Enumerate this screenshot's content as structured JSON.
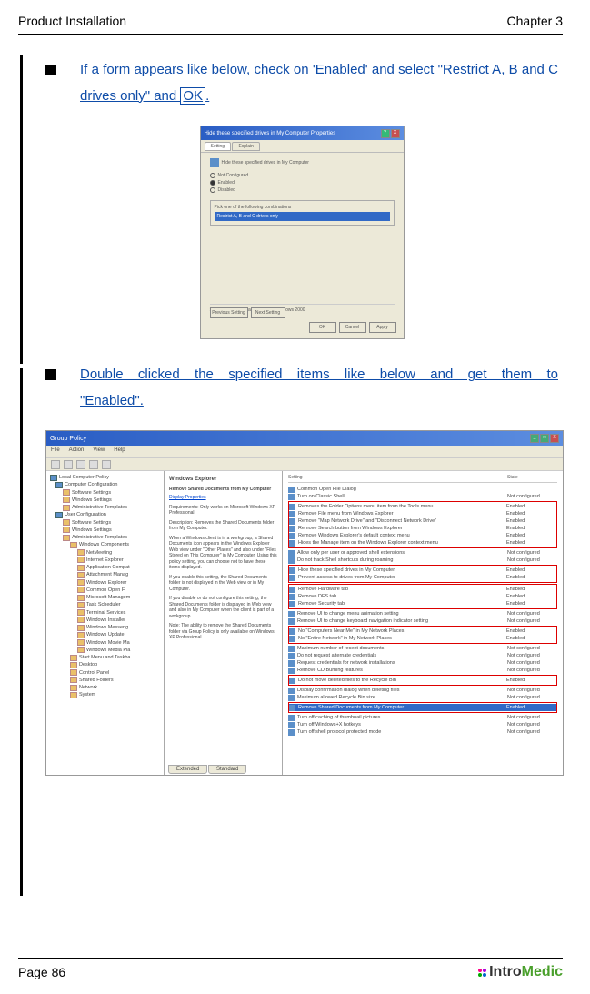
{
  "header": {
    "left": "Product Installation",
    "right": "Chapter 3"
  },
  "bullet1": {
    "pre": "If a form appears like below, check on 'Enabled' and select \"Restrict A, B and C drives only\" and ",
    "ok": "OK",
    "post": "."
  },
  "bullet2": "Double clicked the specified items like below and get them to \"Enabled\".",
  "ss1": {
    "title": "Hide these specified drives in My Computer Properties",
    "tab1": "Setting",
    "tab2": "Explain",
    "header_label": "Hide these specified drives in My Computer",
    "r1": "Not Configured",
    "r2": "Enabled",
    "r3": "Disabled",
    "pick": "Pick one of the following combinations",
    "selected": "Restrict A, B and C drives only",
    "supported": "Supported on:   At least Microsoft Windows 2000",
    "prev": "Previous Setting",
    "next": "Next Setting",
    "ok": "OK",
    "cancel": "Cancel",
    "apply": "Apply"
  },
  "ss2": {
    "title": "Group Policy",
    "menu": [
      "File",
      "Action",
      "View",
      "Help"
    ],
    "tree": [
      {
        "t": "Local Computer Policy",
        "i": 0,
        "c": "blue"
      },
      {
        "t": "Computer Configuration",
        "i": 1,
        "c": "blue"
      },
      {
        "t": "Software Settings",
        "i": 2,
        "c": ""
      },
      {
        "t": "Windows Settings",
        "i": 2,
        "c": ""
      },
      {
        "t": "Administrative Templates",
        "i": 2,
        "c": ""
      },
      {
        "t": "User Configuration",
        "i": 1,
        "c": "blue"
      },
      {
        "t": "Software Settings",
        "i": 2,
        "c": ""
      },
      {
        "t": "Windows Settings",
        "i": 2,
        "c": ""
      },
      {
        "t": "Administrative Templates",
        "i": 2,
        "c": ""
      },
      {
        "t": "Windows Components",
        "i": 3,
        "c": ""
      },
      {
        "t": "NetMeeting",
        "i": 4,
        "c": ""
      },
      {
        "t": "Internet Explorer",
        "i": 4,
        "c": ""
      },
      {
        "t": "Application Compat",
        "i": 4,
        "c": ""
      },
      {
        "t": "Attachment Manag",
        "i": 4,
        "c": ""
      },
      {
        "t": "Windows Explorer",
        "i": 4,
        "c": ""
      },
      {
        "t": "Common Open F",
        "i": 4,
        "c": ""
      },
      {
        "t": "Microsoft Managem",
        "i": 4,
        "c": ""
      },
      {
        "t": "Task Scheduler",
        "i": 4,
        "c": ""
      },
      {
        "t": "Terminal Services",
        "i": 4,
        "c": ""
      },
      {
        "t": "Windows Installer",
        "i": 4,
        "c": ""
      },
      {
        "t": "Windows Messeng",
        "i": 4,
        "c": ""
      },
      {
        "t": "Windows Update",
        "i": 4,
        "c": ""
      },
      {
        "t": "Windows Movie Ma",
        "i": 4,
        "c": ""
      },
      {
        "t": "Windows Media Pla",
        "i": 4,
        "c": ""
      },
      {
        "t": "Start Menu and Taskba",
        "i": 3,
        "c": ""
      },
      {
        "t": "Desktop",
        "i": 3,
        "c": ""
      },
      {
        "t": "Control Panel",
        "i": 3,
        "c": ""
      },
      {
        "t": "Shared Folders",
        "i": 3,
        "c": ""
      },
      {
        "t": "Network",
        "i": 3,
        "c": ""
      },
      {
        "t": "System",
        "i": 3,
        "c": ""
      }
    ],
    "explain_title": "Windows Explorer",
    "explain_head": "Remove Shared Documents from My Computer",
    "explain_link": "Display Properties",
    "explain_req": "Requirements: Only works on Microsoft Windows XP Professional",
    "explain_desc": "Description: Removes the Shared Documents folder from My Computer.",
    "explain_p1": "When a Windows client is in a workgroup, a Shared Documents icon appears in the Windows Explorer Web view under \"Other Places\" and also under \"Files Stored on This Computer\" in My Computer. Using this policy setting, you can choose not to have these items displayed.",
    "explain_p2": "If you enable this setting, the Shared Documents folder is not displayed in the Web view or in My Computer.",
    "explain_p3": "If you disable or do not configure this setting, the Shared Documents folder is displayed in Web view and also in My Computer when the client is part of a workgroup.",
    "explain_p4": "Note: The ability to remove the Shared Documents folder via Group Policy is only available on Windows XP Professional.",
    "list_header1": "Setting",
    "list_header2": "State",
    "tab_ext": "Extended",
    "tab_std": "Standard",
    "groups": [
      {
        "box": false,
        "rows": [
          {
            "t": "Common Open File Dialog",
            "s": ""
          },
          {
            "t": "Turn on Classic Shell",
            "s": "Not configured"
          }
        ]
      },
      {
        "box": true,
        "rows": [
          {
            "t": "Removes the Folder Options menu item from the Tools menu",
            "s": "Enabled"
          },
          {
            "t": "Remove File menu from Windows Explorer",
            "s": "Enabled"
          },
          {
            "t": "Remove \"Map Network Drive\" and \"Disconnect Network Drive\"",
            "s": "Enabled"
          },
          {
            "t": "Remove Search button from Windows Explorer",
            "s": "Enabled"
          },
          {
            "t": "Remove Windows Explorer's default context menu",
            "s": "Enabled"
          },
          {
            "t": "Hides the Manage item on the Windows Explorer context menu",
            "s": "Enabled"
          }
        ]
      },
      {
        "box": false,
        "rows": [
          {
            "t": "Allow only per user or approved shell extensions",
            "s": "Not configured"
          },
          {
            "t": "Do not track Shell shortcuts during roaming",
            "s": "Not configured"
          }
        ]
      },
      {
        "box": true,
        "rows": [
          {
            "t": "Hide these specified drives in My Computer",
            "s": "Enabled"
          },
          {
            "t": "Prevent access to drives from My Computer",
            "s": "Enabled"
          }
        ]
      },
      {
        "box": true,
        "rows": [
          {
            "t": "Remove Hardware tab",
            "s": "Enabled"
          },
          {
            "t": "Remove DFS tab",
            "s": "Enabled"
          },
          {
            "t": "Remove Security tab",
            "s": "Enabled"
          }
        ]
      },
      {
        "box": false,
        "rows": [
          {
            "t": "Remove UI to change menu animation setting",
            "s": "Not configured"
          },
          {
            "t": "Remove UI to change keyboard navigation indicator setting",
            "s": "Not configured"
          }
        ]
      },
      {
        "box": true,
        "rows": [
          {
            "t": "No \"Computers Near Me\" in My Network Places",
            "s": "Enabled"
          },
          {
            "t": "No \"Entire Network\" in My Network Places",
            "s": "Enabled"
          }
        ]
      },
      {
        "box": false,
        "rows": [
          {
            "t": "Maximum number of recent documents",
            "s": "Not configured"
          },
          {
            "t": "Do not request alternate credentials",
            "s": "Not configured"
          },
          {
            "t": "Request credentials for network installations",
            "s": "Not configured"
          },
          {
            "t": "Remove CD Burning features",
            "s": "Not configured"
          }
        ]
      },
      {
        "box": true,
        "rows": [
          {
            "t": "Do not move deleted files to the Recycle Bin",
            "s": "Enabled"
          }
        ]
      },
      {
        "box": false,
        "rows": [
          {
            "t": "Display confirmation dialog when deleting files",
            "s": "Not configured"
          },
          {
            "t": "Maximum allowed Recycle Bin size",
            "s": "Not configured"
          }
        ]
      },
      {
        "box": true,
        "rows": [
          {
            "t": "Remove Shared Documents from My Computer",
            "s": "Enabled",
            "sel": true
          }
        ]
      },
      {
        "box": false,
        "rows": [
          {
            "t": "Turn off caching of thumbnail pictures",
            "s": "Not configured"
          },
          {
            "t": "Turn off Windows+X hotkeys",
            "s": "Not configured"
          },
          {
            "t": "Turn off shell protocol protected mode",
            "s": "Not configured"
          }
        ]
      }
    ]
  },
  "footer": {
    "page": "Page 86",
    "logo1": "Intro",
    "logo2": "Medic"
  }
}
